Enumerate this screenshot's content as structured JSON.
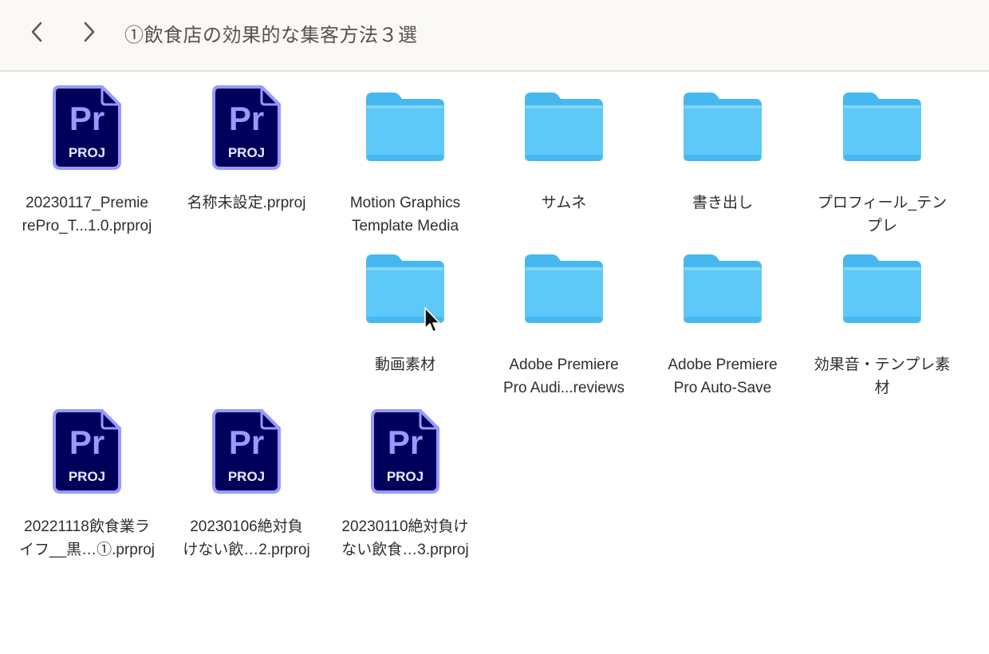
{
  "window": {
    "title": "①飲食店の効果的な集客方法３選"
  },
  "toolbar": {
    "back_icon": "chevron-left-icon",
    "forward_icon": "chevron-right-icon"
  },
  "colors": {
    "folder": "#5ec8f8",
    "premiere_bg": "#00005b",
    "premiere_accent": "#9999ff",
    "toolbar_bg": "#fbf9f5"
  },
  "items": [
    {
      "type": "prproj",
      "label_l1": "20230117_Premie",
      "label_l2": "rePro_T...1.0.prproj",
      "icon_text": "Pr",
      "icon_sub": "PROJ"
    },
    {
      "type": "prproj",
      "label_l1": "名称未設定.prproj",
      "label_l2": "",
      "icon_text": "Pr",
      "icon_sub": "PROJ"
    },
    {
      "type": "folder",
      "label_l1": "Motion Graphics",
      "label_l2": "Template Media"
    },
    {
      "type": "folder",
      "label_l1": "サムネ",
      "label_l2": ""
    },
    {
      "type": "folder",
      "label_l1": "書き出し",
      "label_l2": ""
    },
    {
      "type": "folder",
      "label_l1": "プロフィール_テン",
      "label_l2": "プレ"
    },
    {
      "type": "folder",
      "label_l1": "動画素材",
      "label_l2": ""
    },
    {
      "type": "folder",
      "label_l1": "Adobe Premiere",
      "label_l2": "Pro Audi...reviews"
    },
    {
      "type": "folder",
      "label_l1": "Adobe Premiere",
      "label_l2": "Pro Auto-Save"
    },
    {
      "type": "folder",
      "label_l1": "効果音・テンプレ素",
      "label_l2": "材"
    },
    {
      "type": "prproj",
      "label_l1": "20221118飲食業ラ",
      "label_l2": "イフ__黒…①.prproj",
      "icon_text": "Pr",
      "icon_sub": "PROJ"
    },
    {
      "type": "prproj",
      "label_l1": "20230106絶対負",
      "label_l2": "けない飲…2.prproj",
      "icon_text": "Pr",
      "icon_sub": "PROJ"
    },
    {
      "type": "prproj",
      "label_l1": "20230110絶対負け",
      "label_l2": "ない飲食…3.prproj",
      "icon_text": "Pr",
      "icon_sub": "PROJ"
    }
  ]
}
